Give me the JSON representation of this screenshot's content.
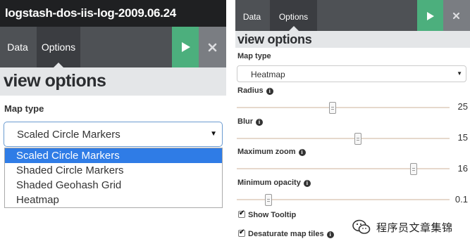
{
  "left": {
    "title": "logstash-dos-iis-log-2009.06.24",
    "tabs": [
      "Data",
      "Options"
    ],
    "active_tab": "Options",
    "header": "view options",
    "map_type_label": "Map type",
    "map_type_value": "Scaled Circle Markers",
    "dropdown_options": [
      "Scaled Circle Markers",
      "Shaded Circle Markers",
      "Shaded Geohash Grid",
      "Heatmap"
    ],
    "selected_option_index": 0
  },
  "right": {
    "tabs": [
      "Data",
      "Options"
    ],
    "active_tab": "Options",
    "header": "view options",
    "map_type_label": "Map type",
    "map_type_value": "Heatmap",
    "sliders": [
      {
        "label": "Radius",
        "value": "25",
        "position": 0.45
      },
      {
        "label": "Blur",
        "value": "15",
        "position": 0.57
      },
      {
        "label": "Maximum zoom",
        "value": "16",
        "position": 0.83
      },
      {
        "label": "Minimum opacity",
        "value": "0.1",
        "position": 0.15
      }
    ],
    "checkboxes": [
      {
        "label": "Show Tooltip",
        "checked": true,
        "info": false
      },
      {
        "label": "Desaturate map tiles",
        "checked": true,
        "info": true
      }
    ]
  },
  "watermark": {
    "text": "程序员文章集锦"
  },
  "colors": {
    "title_bar": "#1f2022",
    "tab_bar": "#4e5155",
    "active_tab": "#3b3d41",
    "apply_green": "#4caf7d",
    "close_gray": "#7a7d82",
    "dropdown_selected": "#2f7ce6",
    "header_bg": "#e4e6e8"
  }
}
